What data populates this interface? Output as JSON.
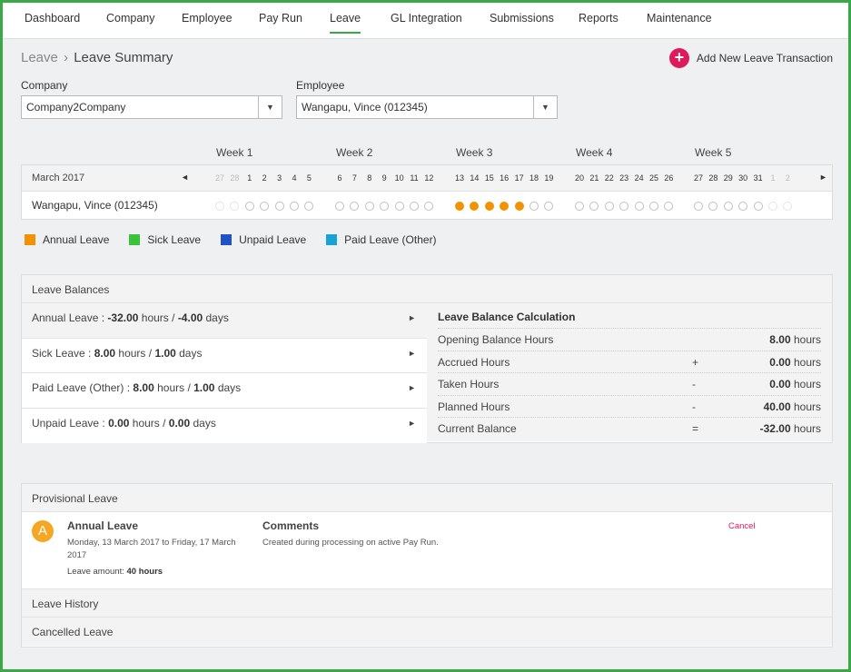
{
  "nav": {
    "tabs": [
      {
        "label": "Dashboard"
      },
      {
        "label": "Company"
      },
      {
        "label": "Employee"
      },
      {
        "label": "Pay Run"
      },
      {
        "label": "Leave"
      },
      {
        "label": "GL Integration"
      },
      {
        "label": "Submissions"
      },
      {
        "label": "Reports"
      },
      {
        "label": "Maintenance"
      }
    ],
    "active": "Leave"
  },
  "breadcrumb": {
    "parent": "Leave",
    "separator": "›",
    "current": "Leave Summary"
  },
  "add_button": {
    "icon": "+",
    "label": "Add New Leave Transaction"
  },
  "filters": {
    "company_label": "Company",
    "company_value": "Company2Company",
    "employee_label": "Employee",
    "employee_value": "Wangapu, Vince (012345)"
  },
  "calendar": {
    "month_label": "March 2017",
    "prev_icon": "◄",
    "next_icon": "►",
    "weeks": [
      "Week 1",
      "Week 2",
      "Week 3",
      "Week 4",
      "Week 5"
    ],
    "days": [
      {
        "n": "27",
        "dim": true
      },
      {
        "n": "28",
        "dim": true
      },
      {
        "n": "1"
      },
      {
        "n": "2"
      },
      {
        "n": "3"
      },
      {
        "n": "4"
      },
      {
        "n": "5"
      },
      {
        "n": "6"
      },
      {
        "n": "7"
      },
      {
        "n": "8"
      },
      {
        "n": "9"
      },
      {
        "n": "10"
      },
      {
        "n": "11"
      },
      {
        "n": "12"
      },
      {
        "n": "13",
        "leave": true
      },
      {
        "n": "14",
        "leave": true
      },
      {
        "n": "15",
        "leave": true
      },
      {
        "n": "16",
        "leave": true
      },
      {
        "n": "17",
        "leave": true
      },
      {
        "n": "18"
      },
      {
        "n": "19"
      },
      {
        "n": "20"
      },
      {
        "n": "21"
      },
      {
        "n": "22"
      },
      {
        "n": "23"
      },
      {
        "n": "24"
      },
      {
        "n": "25"
      },
      {
        "n": "26"
      },
      {
        "n": "27"
      },
      {
        "n": "28"
      },
      {
        "n": "29"
      },
      {
        "n": "30"
      },
      {
        "n": "31"
      },
      {
        "n": "1",
        "dim": true
      },
      {
        "n": "2",
        "dim": true
      }
    ],
    "employee_row": "Wangapu, Vince (012345)"
  },
  "legend": [
    {
      "label": "Annual Leave",
      "color": "#f39200"
    },
    {
      "label": "Sick Leave",
      "color": "#3cc13b"
    },
    {
      "label": "Unpaid Leave",
      "color": "#2053c4"
    },
    {
      "label": "Paid Leave (Other)",
      "color": "#19a2d6"
    }
  ],
  "balances": {
    "title": "Leave Balances",
    "items": [
      {
        "name": "Annual Leave",
        "sep": " : ",
        "hours": "-32.00",
        "hours_unit": " hours / ",
        "days": "-4.00",
        "days_unit": " days",
        "selected": true
      },
      {
        "name": "Sick Leave",
        "sep": " : ",
        "hours": "8.00",
        "hours_unit": " hours / ",
        "days": "1.00",
        "days_unit": " days"
      },
      {
        "name": "Paid Leave (Other)",
        "sep": " : ",
        "hours": "8.00",
        "hours_unit": " hours / ",
        "days": "1.00",
        "days_unit": " days"
      },
      {
        "name": "Unpaid Leave",
        "sep": " : ",
        "hours": "0.00",
        "hours_unit": " hours / ",
        "days": "0.00",
        "days_unit": " days"
      }
    ],
    "arrow_icon": "►",
    "calc": {
      "title": "Leave Balance Calculation",
      "unit": " hours",
      "rows": [
        {
          "label": "Opening Balance Hours",
          "op": "",
          "value": "8.00"
        },
        {
          "label": "Accrued Hours",
          "op": "+",
          "value": "0.00"
        },
        {
          "label": "Taken Hours",
          "op": "-",
          "value": "0.00"
        },
        {
          "label": "Planned Hours",
          "op": "-",
          "value": "40.00"
        },
        {
          "label": "Current Balance",
          "op": "=",
          "value": "-32.00"
        }
      ]
    }
  },
  "provisional": {
    "title": "Provisional Leave",
    "avatar": "A",
    "type": "Annual Leave",
    "dates": "Monday, 13 March 2017 to Friday, 17 March 2017",
    "amount_label": "Leave amount: ",
    "amount_value": "40 hours",
    "comments_heading": "Comments",
    "comment": "Created during processing on active Pay Run.",
    "cancel_label": "Cancel"
  },
  "history": {
    "label": "Leave History"
  },
  "cancelled": {
    "label": "Cancelled Leave"
  }
}
